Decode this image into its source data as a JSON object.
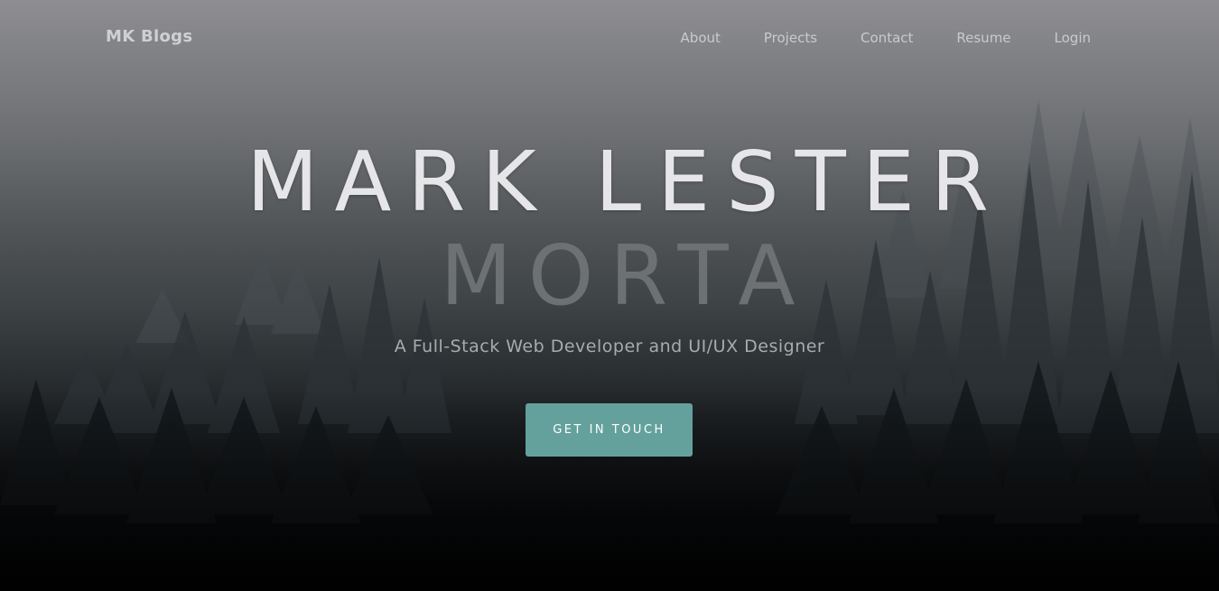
{
  "nav": {
    "brand": "MK Blogs",
    "links": [
      "About",
      "Projects",
      "Contact",
      "Resume",
      "Login"
    ]
  },
  "hero": {
    "title_line1": "MARK LESTER",
    "title_line2": "MORTA",
    "subtitle": "A Full-Stack Web Developer and UI/UX Designer",
    "cta_label": "GET IN TOUCH"
  },
  "colors": {
    "accent": "#64a19d",
    "nav_text": "#c9cacd",
    "title_light": "#e6e6e8",
    "title_dark": "#6e7174"
  }
}
